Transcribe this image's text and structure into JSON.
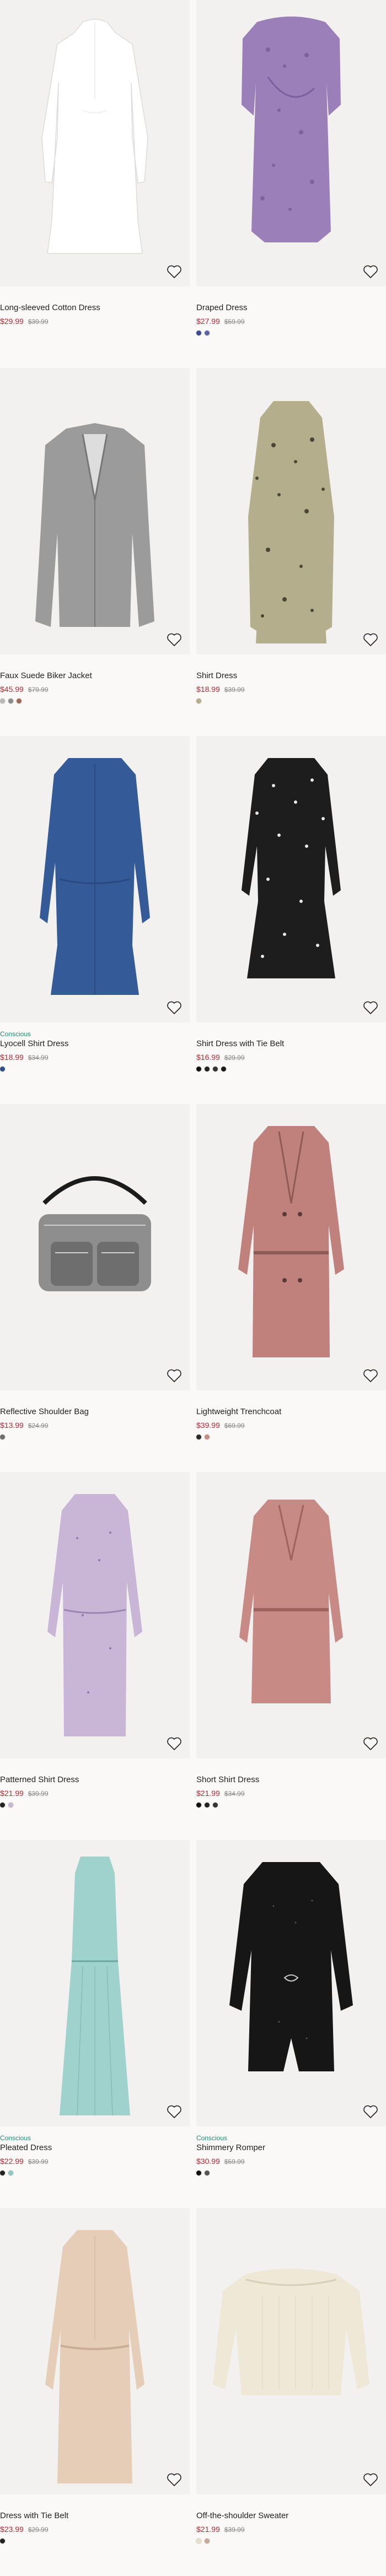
{
  "products": [
    {
      "name": "Long-sleeved Cotton Dress",
      "sale_price": "$29.99",
      "original_price": "$39.99",
      "conscious": "",
      "swatches": [],
      "image": "white-dress"
    },
    {
      "name": "Draped Dress",
      "sale_price": "$27.99",
      "original_price": "$59.99",
      "conscious": "",
      "swatches": [
        "#3b4a8e",
        "#5a63a8"
      ],
      "image": "purple-dress"
    },
    {
      "name": "Faux Suede Biker Jacket",
      "sale_price": "$45.99",
      "original_price": "$79.99",
      "conscious": "",
      "swatches": [
        "#b9b9b9",
        "#8c8c8c",
        "#9c6b5a"
      ],
      "image": "grey-jacket"
    },
    {
      "name": "Shirt Dress",
      "sale_price": "$18.99",
      "original_price": "$39.99",
      "conscious": "",
      "swatches": [
        "#b5ae8c"
      ],
      "image": "leopard-dress"
    },
    {
      "name": "Lyocell Shirt Dress",
      "sale_price": "$18.99",
      "original_price": "$34.99",
      "conscious": "Conscious",
      "swatches": [
        "#2f4f86"
      ],
      "image": "denim-dress"
    },
    {
      "name": "Shirt Dress with Tie Belt",
      "sale_price": "$16.99",
      "original_price": "$29.99",
      "conscious": "",
      "swatches": [
        "#111111",
        "#222222",
        "#333333",
        "#1a1a1a"
      ],
      "image": "black-print-dress"
    },
    {
      "name": "Reflective Shoulder Bag",
      "sale_price": "$13.99",
      "original_price": "$24.99",
      "conscious": "",
      "swatches": [
        "#6e6e6e"
      ],
      "image": "bag"
    },
    {
      "name": "Lightweight Trenchcoat",
      "sale_price": "$39.99",
      "original_price": "$69.99",
      "conscious": "",
      "swatches": [
        "#2b2b2b",
        "#c88b86"
      ],
      "image": "pink-trench"
    },
    {
      "name": "Patterned Shirt Dress",
      "sale_price": "$21.99",
      "original_price": "$39.99",
      "conscious": "",
      "swatches": [
        "#222222",
        "#c9b6d6"
      ],
      "image": "lilac-dress"
    },
    {
      "name": "Short Shirt Dress",
      "sale_price": "$21.99",
      "original_price": "$34.99",
      "conscious": "",
      "swatches": [
        "#111111",
        "#222222",
        "#333333"
      ],
      "image": "rose-dress"
    },
    {
      "name": "Pleated Dress",
      "sale_price": "$22.99",
      "original_price": "$39.99",
      "conscious": "Conscious",
      "swatches": [
        "#222222",
        "#8ec7c2"
      ],
      "image": "mint-dress"
    },
    {
      "name": "Shimmery Romper",
      "sale_price": "$30.99",
      "original_price": "$59.99",
      "conscious": "Conscious",
      "swatches": [
        "#111111",
        "#555555"
      ],
      "image": "black-romper"
    },
    {
      "name": "Dress with Tie Belt",
      "sale_price": "$23.99",
      "original_price": "$29.99",
      "conscious": "",
      "swatches": [
        "#222222"
      ],
      "image": "beige-dress"
    },
    {
      "name": "Off-the-shoulder Sweater",
      "sale_price": "$21.99",
      "original_price": "$39.99",
      "conscious": "",
      "swatches": [
        "#e8dfcc",
        "#c8a89a"
      ],
      "image": "cream-sweater"
    }
  ]
}
